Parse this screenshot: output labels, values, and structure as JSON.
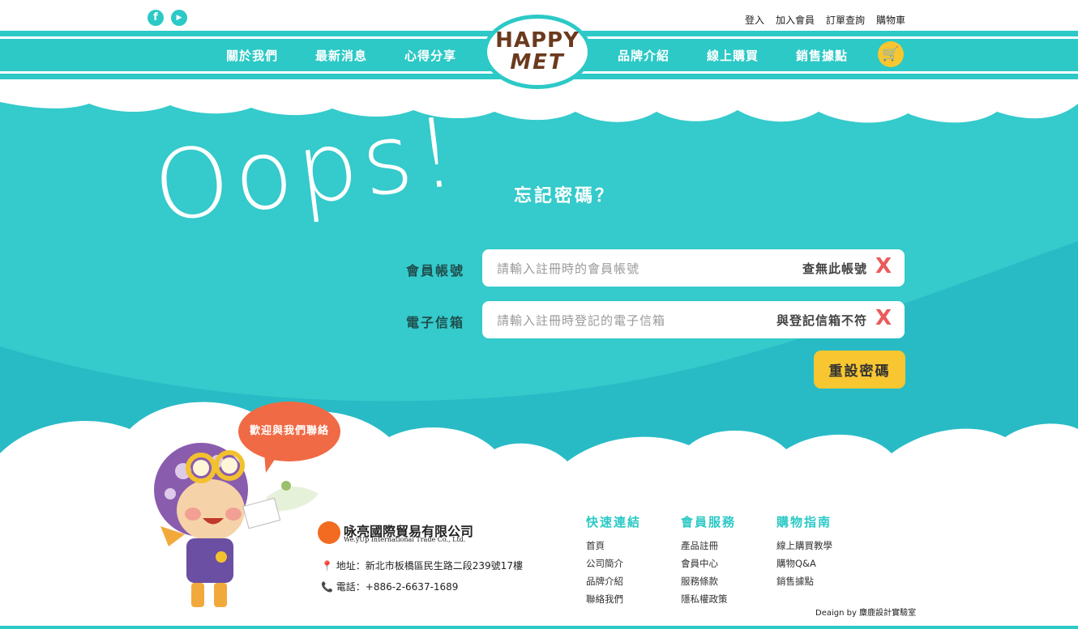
{
  "social": [
    "f",
    "▶"
  ],
  "toplinks": [
    "登入",
    "加入會員",
    "訂單查詢",
    "購物車"
  ],
  "nav": {
    "left": [
      "關於我們",
      "最新消息",
      "心得分享"
    ],
    "right": [
      "品牌介紹",
      "線上購買",
      "銷售據點"
    ],
    "logo_line1": "HAPPY",
    "logo_line2": "MET"
  },
  "hero": {
    "oops": "Oops!",
    "subtitle": "忘記密碼？",
    "account": {
      "label": "會員帳號",
      "placeholder": "請輸入註冊時的會員帳號",
      "error": "查無此帳號",
      "error_mark": "X"
    },
    "email": {
      "label": "電子信箱",
      "placeholder": "請輸入註冊時登記的電子信箱",
      "error": "與登記信箱不符",
      "error_mark": "X"
    },
    "reset_label": "重設密碼"
  },
  "bubble": "歡迎與我們聯絡",
  "company": {
    "name": "咏亮國際貿易有限公司",
    "sub": "We.yUp International Trade Co., Ltd.",
    "address": "地址：新北市板橋區民生路二段239號17樓",
    "phone": "電話：+886-2-6637-1689"
  },
  "footer": {
    "quick": {
      "title": "快速連結",
      "links": [
        "首頁",
        "公司簡介",
        "品牌介紹",
        "聯絡我們"
      ]
    },
    "member": {
      "title": "會員服務",
      "links": [
        "產品註冊",
        "會員中心",
        "服務條款",
        "隱私權政策"
      ]
    },
    "guide": {
      "title": "購物指南",
      "links": [
        "線上購買教學",
        "購物Q&A",
        "銷售據點"
      ]
    },
    "design_credit": "Deaign by 麋鹿設計實驗室"
  },
  "colors": {
    "teal": "#2cc9c6",
    "yellow": "#f7c630",
    "error_red": "#ea5b5b",
    "bubble_orange": "#f06a45"
  }
}
